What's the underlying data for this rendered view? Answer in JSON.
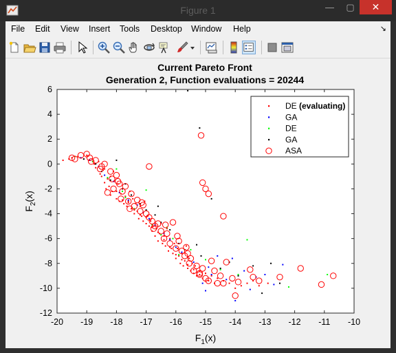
{
  "window": {
    "title": "Figure 1",
    "minimize_glyph": "—",
    "maximize_glyph": "▢",
    "close_glyph": "✕"
  },
  "menu": {
    "items": [
      "File",
      "Edit",
      "View",
      "Insert",
      "Tools",
      "Desktop",
      "Window",
      "Help"
    ],
    "dock_glyph": "↘"
  },
  "toolbar": {
    "icons": [
      "new-figure-icon",
      "open-file-icon",
      "save-icon",
      "print-icon",
      "edit-plot-arrow-icon",
      "zoom-in-icon",
      "zoom-out-icon",
      "pan-hand-icon",
      "rotate-3d-icon",
      "data-cursor-icon",
      "brush-icon",
      "brush-dropdown-icon",
      "link-plot-icon",
      "colorbar-icon",
      "legend-icon",
      "hide-plot-tools-icon",
      "show-plot-tools-icon"
    ]
  },
  "colors": {
    "de_evaluating": "#ff0000",
    "ga_evaluating": "#0000ff",
    "de": "#00ff00",
    "ga": "#000000",
    "asa": "#ff0000",
    "close_button": "#c7322b"
  },
  "chart_data": {
    "type": "scatter",
    "title": "Current Pareto Front",
    "subtitle": "Generation 2, Function evaluations = 20244",
    "xlabel_main": "F",
    "xlabel_sub": "1",
    "xlabel_tail": "(x)",
    "ylabel_main": "F",
    "ylabel_sub": "2",
    "ylabel_tail": "(x)",
    "xlim": [
      -20,
      -10
    ],
    "ylim": [
      -12,
      6
    ],
    "xticks": [
      "-20",
      "-19",
      "-18",
      "-17",
      "-16",
      "-15",
      "-14",
      "-13",
      "-12",
      "-11",
      "-10"
    ],
    "yticks": [
      "6",
      "4",
      "2",
      "0",
      "-2",
      "-4",
      "-6",
      "-8",
      "-10",
      "-12"
    ],
    "legend_position": "top-right",
    "legend": [
      {
        "label": "DE",
        "label_suffix": " (evaluating)",
        "marker": "dot",
        "color": "#ff0000"
      },
      {
        "label": "GA",
        "label_suffix": "",
        "marker": "dot",
        "color": "#0000ff"
      },
      {
        "label": "DE",
        "label_suffix": "",
        "marker": "dot",
        "color": "#00ff00"
      },
      {
        "label": "GA",
        "label_suffix": "",
        "marker": "dot",
        "color": "#000000"
      },
      {
        "label": "ASA",
        "label_suffix": "",
        "marker": "circle",
        "color": "#ff0000"
      }
    ],
    "series": [
      {
        "name": "DE (evaluating)",
        "marker": "dot",
        "color": "#ff0000",
        "x": [
          -19.8,
          -19.6,
          -19.5,
          -19.3,
          -19.2,
          -19.1,
          -19.0,
          -18.9,
          -18.8,
          -18.75,
          -18.7,
          -18.6,
          -18.55,
          -18.5,
          -18.45,
          -18.4,
          -18.35,
          -18.3,
          -18.25,
          -18.2,
          -18.15,
          -18.1,
          -18.05,
          -18.0,
          -17.95,
          -17.9,
          -17.85,
          -17.8,
          -17.75,
          -17.7,
          -17.65,
          -17.6,
          -17.55,
          -17.5,
          -17.45,
          -17.4,
          -17.35,
          -17.3,
          -17.25,
          -17.2,
          -17.15,
          -17.1,
          -17.05,
          -17.0,
          -16.95,
          -16.9,
          -16.85,
          -16.8,
          -16.75,
          -16.7,
          -16.65,
          -16.6,
          -16.55,
          -16.5,
          -16.45,
          -16.4,
          -16.35,
          -16.3,
          -16.25,
          -16.2,
          -16.15,
          -16.1,
          -16.05,
          -16.0,
          -15.95,
          -15.9,
          -15.85,
          -15.8,
          -15.75,
          -15.7,
          -15.65,
          -15.6,
          -15.55,
          -15.5,
          -15.45,
          -15.4,
          -15.35,
          -15.3,
          -15.2,
          -15.1,
          -15.0,
          -14.9,
          -14.8,
          -14.7,
          -14.6,
          -14.4,
          -14.2,
          -14.0,
          -13.8,
          -13.6,
          -13.4,
          -13.2,
          -12.9,
          -18.6,
          -18.4,
          -18.2,
          -18.0,
          -17.8,
          -17.6,
          -17.4,
          -17.2,
          -17.0,
          -16.8,
          -16.6,
          -16.4,
          -16.2,
          -16.0,
          -15.8,
          -15.6,
          -15.4,
          -15.2
        ],
        "y": [
          0.3,
          0.4,
          0.5,
          0.6,
          0.5,
          0.4,
          0.7,
          0.3,
          0.2,
          0.0,
          -0.3,
          -0.2,
          -0.8,
          -1.0,
          -0.5,
          -1.5,
          -2.0,
          -1.2,
          -1.8,
          -2.5,
          -2.2,
          -0.6,
          -1.4,
          -2.8,
          -1.6,
          -3.0,
          -2.4,
          -2.0,
          -3.2,
          -2.6,
          -3.4,
          -3.0,
          -2.2,
          -3.6,
          -2.8,
          -4.0,
          -3.2,
          -3.8,
          -4.4,
          -3.4,
          -4.2,
          -4.6,
          -3.0,
          -4.8,
          -4.2,
          -5.0,
          -4.6,
          -5.4,
          -5.0,
          -5.8,
          -5.2,
          -6.2,
          -5.6,
          -4.8,
          -6.4,
          -5.8,
          -6.6,
          -5.2,
          -7.0,
          -6.0,
          -6.8,
          -7.2,
          -6.4,
          -7.6,
          -6.8,
          -7.4,
          -8.0,
          -7.2,
          -8.2,
          -7.8,
          -6.6,
          -8.4,
          -7.6,
          -8.6,
          -8.0,
          -8.8,
          -8.2,
          -9.0,
          -8.6,
          -9.2,
          -8.8,
          -9.4,
          -9.0,
          -9.6,
          -9.2,
          -9.4,
          -9.6,
          -10.0,
          -9.8,
          -9.6,
          -9.4,
          -9.8,
          -9.6,
          0.2,
          -0.4,
          -1.0,
          -2.2,
          -2.9,
          -3.1,
          -3.7,
          -4.1,
          -4.3,
          -5.1,
          -5.5,
          -6.1,
          -6.7,
          -7.3,
          -7.7,
          -8.1,
          -8.5,
          -8.9
        ]
      },
      {
        "name": "GA",
        "marker": "dot",
        "color": "#0000ff",
        "x": [
          -19.2,
          -18.9,
          -18.6,
          -18.4,
          -18.1,
          -17.9,
          -17.6,
          -17.3,
          -17.1,
          -16.9,
          -16.7,
          -16.4,
          -16.2,
          -16.0,
          -15.8,
          -15.6,
          -15.4,
          -15.1,
          -14.9,
          -14.6,
          -14.3,
          -14.0,
          -13.7,
          -13.3,
          -13.0,
          -12.7,
          -12.4,
          -15.0,
          -14.8,
          -14.1,
          -13.5
        ],
        "y": [
          0.5,
          0.3,
          -0.2,
          -0.9,
          -1.4,
          -2.3,
          -2.9,
          -3.3,
          -3.9,
          -4.4,
          -4.9,
          -5.6,
          -6.1,
          -6.7,
          -7.1,
          -7.5,
          -7.9,
          -9.6,
          -8.3,
          -7.4,
          -9.3,
          -11.0,
          -8.6,
          -9.1,
          -8.9,
          -9.7,
          -8.1,
          -10.2,
          -8.9,
          -7.6,
          -10.1
        ]
      },
      {
        "name": "DE",
        "marker": "dot",
        "color": "#00ff00",
        "x": [
          -19.4,
          -18.8,
          -18.3,
          -18.0,
          -17.7,
          -17.4,
          -17.0,
          -16.8,
          -16.5,
          -16.1,
          -15.9,
          -15.5,
          -15.0,
          -14.5,
          -13.9,
          -13.6,
          -12.2,
          -10.9,
          -16.3,
          -17.8
        ],
        "y": [
          0.6,
          0.2,
          -1.1,
          -0.4,
          -2.7,
          -3.6,
          -2.1,
          -4.9,
          -5.7,
          -6.0,
          -7.3,
          -6.9,
          -7.7,
          -8.5,
          -8.9,
          -6.1,
          -9.9,
          -8.9,
          -5.1,
          -2.2
        ]
      },
      {
        "name": "GA",
        "marker": "dot",
        "color": "#000000",
        "x": [
          -19.1,
          -18.7,
          -18.5,
          -18.2,
          -18.0,
          -17.8,
          -17.5,
          -17.2,
          -17.0,
          -16.7,
          -16.5,
          -16.2,
          -15.9,
          -15.7,
          -15.6,
          -15.2,
          -15.15,
          -14.8,
          -14.5,
          -14.2,
          -13.9,
          -13.4,
          -13.1,
          -12.8,
          -12.5,
          -15.3,
          -16.6,
          -17.7
        ],
        "y": [
          0.4,
          0.0,
          -0.6,
          -1.3,
          0.3,
          -2.0,
          -2.5,
          -3.2,
          -3.7,
          -4.1,
          -4.7,
          -5.3,
          -6.4,
          -6.9,
          5.9,
          2.9,
          -7.4,
          -2.8,
          -8.4,
          -7.9,
          -9.0,
          -8.2,
          -10.4,
          -8.0,
          -9.6,
          -6.5,
          -3.4,
          -1.6
        ]
      },
      {
        "name": "ASA",
        "marker": "circle",
        "color": "#ff0000",
        "x": [
          -19.5,
          -19.2,
          -19.0,
          -18.9,
          -18.7,
          -18.5,
          -18.4,
          -18.2,
          -18.15,
          -18.1,
          -18.0,
          -17.9,
          -17.85,
          -17.8,
          -17.7,
          -17.6,
          -17.5,
          -17.4,
          -17.3,
          -17.2,
          -17.1,
          -17.0,
          -16.9,
          -16.8,
          -16.7,
          -16.6,
          -16.5,
          -16.4,
          -16.3,
          -16.2,
          -16.1,
          -16.0,
          -15.9,
          -15.8,
          -15.7,
          -15.6,
          -15.55,
          -15.5,
          -15.4,
          -15.3,
          -15.2,
          -15.1,
          -15.0,
          -14.9,
          -14.8,
          -14.7,
          -14.6,
          -14.5,
          -14.4,
          -14.3,
          -14.1,
          -14.0,
          -13.9,
          -13.5,
          -13.4,
          -13.2,
          -12.5,
          -11.8,
          -11.1,
          -10.7,
          -16.9,
          -15.15,
          -15.1,
          -15.0,
          -14.9,
          -14.4,
          -15.2,
          -18.3,
          -17.95,
          -17.55,
          -17.15,
          -16.75,
          -16.35,
          -15.95,
          -15.65,
          -19.4,
          -18.85,
          -18.55
        ],
        "y": [
          0.5,
          0.7,
          0.8,
          0.5,
          0.3,
          -0.2,
          0.0,
          -0.6,
          -1.2,
          -2.0,
          -0.9,
          -1.6,
          -2.8,
          -2.2,
          -1.8,
          -3.0,
          -2.4,
          -3.4,
          -2.9,
          -3.8,
          -3.3,
          -4.0,
          -4.3,
          -4.6,
          -5.0,
          -4.8,
          -5.4,
          -6.0,
          -5.6,
          -6.4,
          -4.7,
          -6.8,
          -6.2,
          -7.0,
          -7.4,
          -7.2,
          -8.0,
          -7.6,
          -8.6,
          -8.2,
          -8.8,
          -8.4,
          -9.2,
          -9.4,
          -7.8,
          -8.6,
          -9.6,
          -9.0,
          -9.6,
          -7.9,
          -9.2,
          -10.6,
          -9.5,
          -8.5,
          -9.1,
          -9.4,
          -9.1,
          -8.4,
          -9.7,
          -9.0,
          -0.2,
          2.3,
          -1.5,
          -2.0,
          -2.4,
          -4.2,
          -8.9,
          -2.3,
          -1.4,
          -3.6,
          -3.1,
          -5.2,
          -4.9,
          -5.8,
          -6.7,
          0.4,
          0.2,
          -0.4
        ]
      }
    ]
  }
}
